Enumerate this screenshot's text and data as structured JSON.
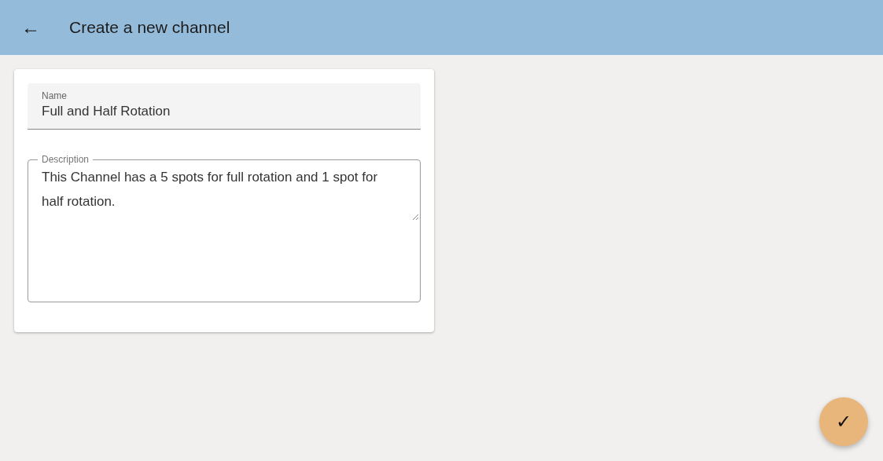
{
  "app_bar": {
    "back": "←",
    "title": "Create a new channel"
  },
  "form": {
    "name": {
      "label": "Name",
      "value": "Full and Half Rotation"
    },
    "description": {
      "label": "Description",
      "value": "This Channel has a 5 spots for full rotation and 1 spot for half rotation."
    }
  },
  "fab": {
    "icon": "✓"
  }
}
